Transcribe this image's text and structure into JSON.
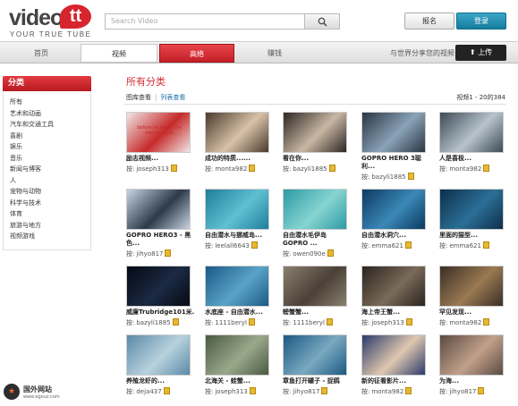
{
  "header": {
    "logo_word": "video.",
    "logo_tt": "tt",
    "tagline": "YOUR TRUE TUBE",
    "search_placeholder": "Search Video",
    "search_icon": "magnifier-icon",
    "register_label": "报名",
    "login_label": "登录"
  },
  "nav": {
    "tabs": [
      "首页",
      "视频",
      "高络",
      "赚钱"
    ],
    "share_text": "与世界分享您的视频",
    "upload_label": "上传"
  },
  "sidebar": {
    "title": "分类",
    "items": [
      "所有",
      "艺术和动画",
      "汽车和交通工具",
      "喜剧",
      "娱乐",
      "音乐",
      "新闻与博客",
      "人",
      "宠物与动物",
      "科学与技术",
      "体育",
      "旅游与地方",
      "视频游戏"
    ]
  },
  "main": {
    "title": "所有分类",
    "view_gallery": "图库查看",
    "view_list": "列表查看",
    "count_text": "视频1 - 20的384",
    "user_prefix": "按:"
  },
  "videos": [
    {
      "title": "励志视频...",
      "user": "joseph313",
      "thumb": "#f1e6e6",
      "accent": "#c62a2a",
      "thumb_text": "before he made the electric light"
    },
    {
      "title": "成功的特质......",
      "user": "monta982",
      "thumb": "#4a3a2c",
      "accent": "#d8c2a8"
    },
    {
      "title": "看在你...",
      "user": "bazyli1885",
      "thumb": "#2b2623",
      "accent": "#c9b7a4"
    },
    {
      "title": "GOPRO HERO 3聪利...",
      "user": "bazyli1885",
      "thumb": "#2a3542",
      "accent": "#8aa3b8"
    },
    {
      "title": "人是喜极...",
      "user": "monta982",
      "thumb": "#3c4a56",
      "accent": "#b7c4cc"
    },
    {
      "title": "GOPRO HERO3 - 黑色...",
      "user": "jihyo817",
      "thumb": "#c8d4e2",
      "accent": "#2c3a4a"
    },
    {
      "title": "自由潜水与挪威岛...",
      "user": "leelall6643",
      "thumb": "#1f7e9a",
      "accent": "#5fc0d2"
    },
    {
      "title": "自由潜水毛伊岛GOPRO ...",
      "user": "owen090e",
      "thumb": "#2d9aa6",
      "accent": "#86d4d0"
    },
    {
      "title": "自由潜水洞穴...",
      "user": "emma621",
      "thumb": "#0c3a60",
      "accent": "#3b88b8"
    },
    {
      "title": "里面的猫型...",
      "user": "emma621",
      "thumb": "#0d2f4a",
      "accent": "#2b6f96"
    },
    {
      "title": "威廉Trubridge101米...",
      "user": "bazyli1885",
      "thumb": "#060a14",
      "accent": "#1b2a44"
    },
    {
      "title": "水底座 - 自由潜水...",
      "user": "1111beryl",
      "thumb": "#1a5a86",
      "accent": "#5aa3c8"
    },
    {
      "title": "螃蟹蟹...",
      "user": "1111beryl",
      "thumb": "#8a8070",
      "accent": "#4a4036"
    },
    {
      "title": "海上帝王蟹...",
      "user": "joseph313",
      "thumb": "#2a2420",
      "accent": "#7a6a58"
    },
    {
      "title": "罕见发现...",
      "user": "monta982",
      "thumb": "#3a2e26",
      "accent": "#9a7a52"
    },
    {
      "title": "养殖龙虾的...",
      "user": "deja437",
      "thumb": "#5a8aa6",
      "accent": "#b8d2de"
    },
    {
      "title": "北海关 - 蛙蟹...",
      "user": "joseph313",
      "thumb": "#4a5a44",
      "accent": "#9aa88a"
    },
    {
      "title": "章鱼打开罐子 - 捉鸥",
      "user": "jihyo817",
      "thumb": "#1c5a82",
      "accent": "#7aa8c0"
    },
    {
      "title": "新的征看影片...",
      "user": "monta982",
      "thumb": "#2a3a6a",
      "accent": "#e0c8b0"
    },
    {
      "title": "为海...",
      "user": "jihyo817",
      "thumb": "#5a4a42",
      "accent": "#c2a08a"
    }
  ],
  "footer": {
    "site_name": "国外网站",
    "site_url": "www.egouz.com"
  }
}
